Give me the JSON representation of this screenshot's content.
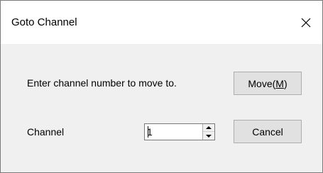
{
  "window": {
    "title": "Goto Channel",
    "close_icon": "close-icon"
  },
  "form": {
    "prompt": "Enter channel number to move to.",
    "channel_label": "Channel",
    "channel_value": "1"
  },
  "buttons": {
    "move_label": "Move(",
    "move_mnemonic": "M",
    "move_suffix": ")",
    "cancel_label": "Cancel"
  },
  "icons": {
    "spin_up": "spin-up-icon",
    "spin_down": "spin-down-icon"
  }
}
